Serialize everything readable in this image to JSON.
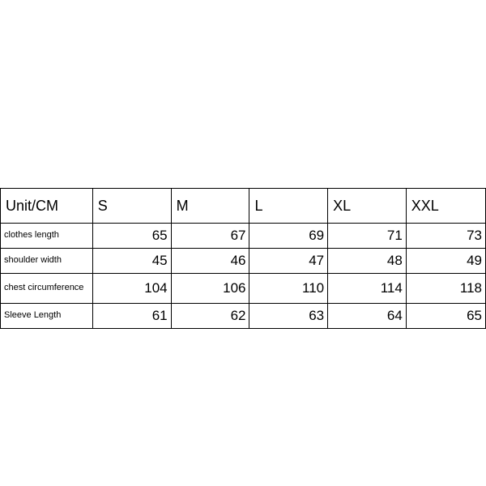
{
  "chart_data": {
    "type": "table",
    "title": "Unit/CM",
    "columns": [
      "S",
      "M",
      "L",
      "XL",
      "XXL"
    ],
    "rows": [
      {
        "label": "clothes length",
        "values": [
          65,
          67,
          69,
          71,
          73
        ]
      },
      {
        "label": "shoulder width",
        "values": [
          45,
          46,
          47,
          48,
          49
        ]
      },
      {
        "label": "chest circumference",
        "values": [
          104,
          106,
          110,
          114,
          118
        ]
      },
      {
        "label": "Sleeve Length",
        "values": [
          61,
          62,
          63,
          64,
          65
        ]
      }
    ]
  }
}
